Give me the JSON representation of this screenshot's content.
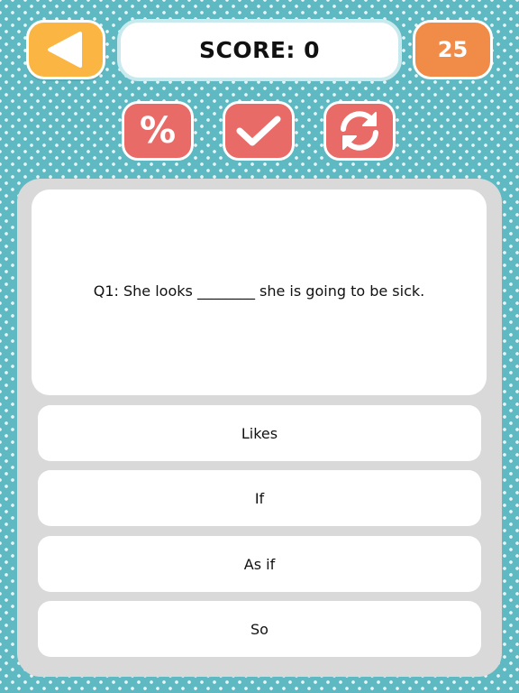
{
  "header": {
    "back_icon": "back-arrow-icon",
    "score_text": "SCORE: 0",
    "timer_value": "25"
  },
  "tools": [
    {
      "name": "percent",
      "icon": "percent-icon",
      "glyph": "%"
    },
    {
      "name": "check",
      "icon": "checkmark-icon"
    },
    {
      "name": "refresh",
      "icon": "refresh-icon"
    }
  ],
  "question": {
    "text": "Q1: She looks ________ she is going to be sick."
  },
  "answers": [
    {
      "label": "Likes"
    },
    {
      "label": "If"
    },
    {
      "label": "As if"
    },
    {
      "label": "So"
    }
  ],
  "colors": {
    "background": "#5fb9c3",
    "back_button": "#fbb543",
    "timer": "#f08b48",
    "tool_button": "#e86b68",
    "panel": "#d9d9d9",
    "card": "#ffffff"
  }
}
